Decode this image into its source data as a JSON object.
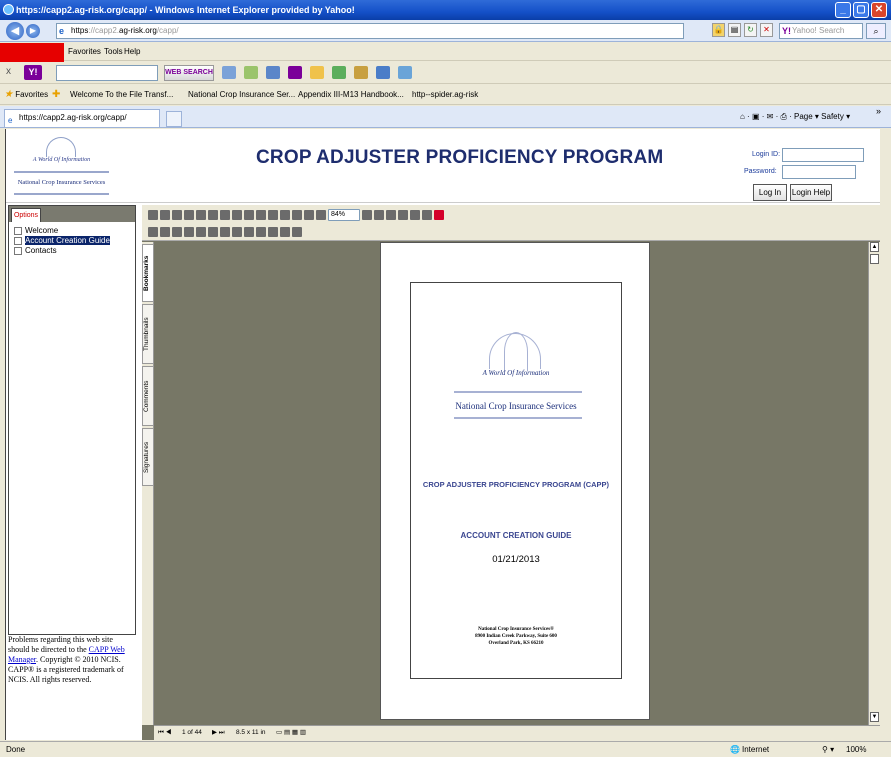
{
  "window": {
    "title": "https://capp2.ag-risk.org/capp/ - Windows Internet Explorer provided by Yahoo!",
    "controls": [
      "_",
      "▢",
      "✕"
    ]
  },
  "address": {
    "url_prefix": "https",
    "url_host": "://capp2.",
    "url_main": "ag-risk.org",
    "url_tail": "/capp/",
    "search_placeholder": "Yahoo! Search",
    "search_logo": "Y!"
  },
  "menu": {
    "items": [
      "Favorites",
      "Tools",
      "Help"
    ]
  },
  "yahoo_toolbar": {
    "logo": "Y!",
    "web_search": "WEB SEARCH"
  },
  "favorites": {
    "label": "Favorites",
    "items": [
      "Welcome To the File Transf...",
      "National Crop Insurance Ser...",
      "Appendix III-M13 Handbook...",
      "http--spider.ag-risk"
    ]
  },
  "tab": {
    "label": "https://capp2.ag-risk.org/capp/"
  },
  "command_bar": {
    "page": "Page",
    "safety": "Safety"
  },
  "site": {
    "logo_tag": "A World Of Information",
    "logo_name": "National Crop Insurance Services",
    "title": "CROP ADJUSTER PROFICIENCY PROGRAM",
    "login_id_label": "Login ID:",
    "password_label": "Password:",
    "login_button": "Log In",
    "login_help_button": "Login Help"
  },
  "options": {
    "tab_label": "Options",
    "items": [
      "Welcome",
      "Account Creation Guide",
      "Contacts"
    ],
    "selected": "Account Creation Guide"
  },
  "notice": {
    "text1": "Problems regarding this web site should be directed to the ",
    "link": "CAPP Web Manager",
    "text2": ". Copyright © 2010 NCIS. CAPP® is a registered trademark of NCIS. All rights reserved."
  },
  "viewer": {
    "zoom": "84%",
    "side_tabs": [
      "Bookmarks",
      "Thumbnails",
      "Comments",
      "Signatures"
    ],
    "page_indicator": "1 of 44",
    "page_size": "8.5 x 11 in",
    "doc": {
      "logo_tag": "A World Of Information",
      "logo_name": "National Crop Insurance Services",
      "program": "CROP ADJUSTER PROFICIENCY PROGRAM (CAPP)",
      "guide": "ACCOUNT CREATION GUIDE",
      "date": "01/21/2013",
      "addr1": "National Crop Insurance Services®",
      "addr2": "8900 Indian Creek Parkway, Suite 600",
      "addr3": "Overland Park, KS 66210"
    }
  },
  "status": {
    "left": "Done",
    "zone": "Internet",
    "zoom": "100%"
  },
  "colors": {
    "title_blue": "#1e2d6e",
    "selection": "#0a246a",
    "viewer_bg": "#777766",
    "red_box": "#e60000"
  }
}
